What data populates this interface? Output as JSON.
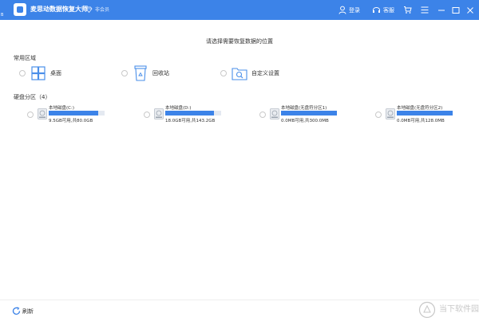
{
  "window": {
    "title": "麦思动数据恢复大师",
    "vip_label": "非会员",
    "corner_mark": "B",
    "login_label": "登录",
    "service_label": "客服"
  },
  "main": {
    "prompt": "请选择需要恢复数据的位置"
  },
  "common": {
    "title": "常用区域",
    "items": [
      {
        "label": "桌面",
        "icon": "windows-icon"
      },
      {
        "label": "回收站",
        "icon": "recycle-bin-icon"
      },
      {
        "label": "自定义设置",
        "icon": "folder-search-icon"
      }
    ]
  },
  "partitions": {
    "title": "硬盘分区（4）",
    "disks": [
      {
        "name": "本地磁盘(C:)",
        "size_text": "9.5GB可用,共80.0GB",
        "used_fraction": 0.88
      },
      {
        "name": "本地磁盘(D:)",
        "size_text": "18.0GB可用,共143.2GB",
        "used_fraction": 0.87
      },
      {
        "name": "本地磁盘(无盘符分区1)",
        "size_text": "0.0MB可用,共300.0MB",
        "used_fraction": 1.0
      },
      {
        "name": "本地磁盘(无盘符分区2)",
        "size_text": "0.0MB可用,共128.0MB",
        "used_fraction": 1.0
      }
    ]
  },
  "footer": {
    "refresh_label": "刷新",
    "watermark": "当下软件园"
  },
  "colors": {
    "accent": "#3c83e8",
    "bar_track": "#e4e9f1"
  }
}
